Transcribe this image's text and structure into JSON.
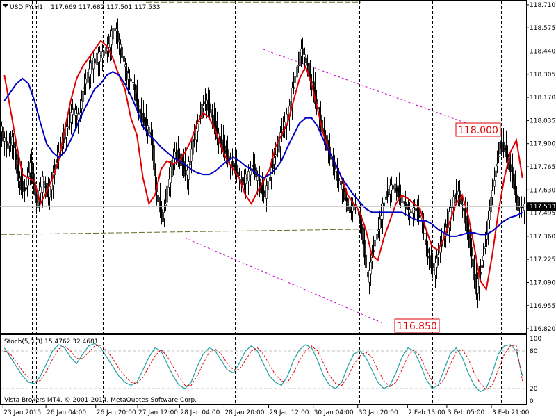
{
  "header": {
    "symbol_tf": "USDJPY,H1",
    "ohlc": "117.669 117.682 117.501 117.533"
  },
  "sub_header": "Stoch(5,3,3) 15.4762 32.4681",
  "copyright": "Vista Brokers MT4, © 2001-2014, MetaQuotes Software Corp.",
  "chart_data": {
    "type": "candlestick",
    "price_axis": {
      "ylim": [
        116.8,
        118.73
      ],
      "ticks": [
        "118.710",
        "118.575",
        "118.440",
        "118.305",
        "118.170",
        "118.035",
        "117.900",
        "117.765",
        "117.630",
        "117.495",
        "117.360",
        "117.225",
        "117.090",
        "116.955",
        "116.820"
      ],
      "current_price": "117.533"
    },
    "time_axis": {
      "labels": [
        "23 Jan 2015",
        "26 Jan 04:00",
        "26 Jan 20:00",
        "27 Jan 12:00",
        "28 Jan 04:00",
        "28 Jan 20:00",
        "29 Jan 12:00",
        "30 Jan 04:00",
        "30 Jan 20:00",
        "2 Feb 13:00",
        "3 Feb 05:00",
        "3 Feb 21:00"
      ]
    },
    "annotations": {
      "high_label": "118.000",
      "low_label": "116.850"
    },
    "price_series": [
      118.0,
      117.88,
      117.92,
      117.7,
      117.62,
      117.78,
      117.55,
      117.68,
      117.6,
      117.75,
      117.88,
      117.98,
      118.1,
      118.05,
      118.25,
      118.35,
      118.4,
      118.42,
      118.48,
      118.58,
      118.45,
      118.3,
      118.25,
      118.1,
      118.02,
      117.95,
      117.6,
      117.45,
      117.7,
      117.85,
      117.8,
      117.72,
      117.9,
      118.05,
      118.15,
      118.08,
      117.95,
      117.88,
      117.8,
      117.75,
      117.68,
      117.7,
      117.78,
      117.65,
      117.6,
      117.75,
      117.88,
      118.0,
      118.1,
      118.3,
      118.45,
      118.35,
      118.2,
      118.05,
      117.92,
      117.8,
      117.7,
      117.62,
      117.5,
      117.55,
      117.4,
      117.1,
      117.3,
      117.45,
      117.6,
      117.65,
      117.62,
      117.55,
      117.5,
      117.52,
      117.45,
      117.25,
      117.15,
      117.3,
      117.4,
      117.55,
      117.62,
      117.5,
      117.3,
      117.05,
      117.2,
      117.45,
      117.7,
      117.9,
      117.85,
      117.7,
      117.53
    ],
    "moving_averages": [
      {
        "color": "#e00000",
        "values": [
          118.3,
          118.1,
          117.9,
          117.72,
          117.7,
          117.68,
          117.55,
          117.62,
          117.7,
          117.8,
          117.98,
          118.15,
          118.28,
          118.35,
          118.4,
          118.45,
          118.5,
          118.47,
          118.4,
          118.3,
          118.22,
          118.05,
          117.95,
          117.7,
          117.55,
          117.6,
          117.75,
          117.8,
          117.78,
          117.8,
          117.85,
          117.92,
          118.02,
          118.08,
          118.05,
          117.98,
          117.88,
          117.8,
          117.75,
          117.7,
          117.6,
          117.55,
          117.62,
          117.68,
          117.75,
          117.88,
          117.95,
          118.02,
          118.15,
          118.28,
          118.35,
          118.25,
          118.1,
          117.95,
          117.85,
          117.78,
          117.7,
          117.6,
          117.55,
          117.5,
          117.4,
          117.25,
          117.22,
          117.35,
          117.45,
          117.55,
          117.6,
          117.58,
          117.55,
          117.52,
          117.4,
          117.3,
          117.28,
          117.35,
          117.45,
          117.55,
          117.6,
          117.48,
          117.3,
          117.1,
          117.05,
          117.25,
          117.5,
          117.7,
          117.85,
          117.92,
          117.7
        ]
      },
      {
        "color": "#0000c0",
        "values": [
          118.15,
          118.2,
          118.25,
          118.28,
          118.25,
          118.15,
          118.02,
          117.9,
          117.85,
          117.82,
          117.85,
          117.92,
          118.0,
          118.08,
          118.15,
          118.22,
          118.25,
          118.3,
          118.32,
          118.3,
          118.25,
          118.18,
          118.1,
          118.0,
          117.95,
          117.92,
          117.88,
          117.85,
          117.82,
          117.8,
          117.78,
          117.75,
          117.73,
          117.72,
          117.72,
          117.74,
          117.77,
          117.8,
          117.82,
          117.8,
          117.77,
          117.75,
          117.72,
          117.7,
          117.72,
          117.75,
          117.8,
          117.88,
          117.95,
          118.02,
          118.05,
          118.05,
          118.0,
          117.92,
          117.85,
          117.78,
          117.7,
          117.65,
          117.6,
          117.56,
          117.52,
          117.5,
          117.5,
          117.5,
          117.5,
          117.5,
          117.5,
          117.48,
          117.46,
          117.45,
          117.45,
          117.43,
          117.4,
          117.38,
          117.36,
          117.36,
          117.37,
          117.38,
          117.38,
          117.37,
          117.37,
          117.39,
          117.42,
          117.45,
          117.47,
          117.48,
          117.5
        ]
      }
    ],
    "channel_lines": {
      "upper": {
        "from": [
          0.5,
          118.45
        ],
        "to": [
          0.95,
          117.95
        ]
      },
      "lower": {
        "from": [
          0.35,
          117.35
        ],
        "to": [
          0.73,
          116.85
        ]
      }
    },
    "horizontal_levels": [
      118.725,
      117.37
    ],
    "stochastic": {
      "ylim": [
        0,
        100
      ],
      "levels": [
        20,
        80
      ],
      "tick_labels": [
        "100",
        "80",
        "20",
        "0"
      ],
      "main": [
        85,
        70,
        55,
        40,
        30,
        28,
        40,
        60,
        80,
        90,
        85,
        70,
        60,
        75,
        88,
        92,
        85,
        70,
        55,
        40,
        30,
        25,
        30,
        50,
        70,
        85,
        80,
        60,
        40,
        25,
        20,
        30,
        55,
        75,
        85,
        80,
        65,
        50,
        45,
        60,
        80,
        88,
        80,
        60,
        40,
        30,
        25,
        40,
        65,
        82,
        90,
        85,
        65,
        40,
        25,
        20,
        30,
        55,
        75,
        80,
        70,
        50,
        30,
        20,
        25,
        45,
        70,
        85,
        80,
        60,
        35,
        20,
        25,
        50,
        75,
        85,
        70,
        45,
        25,
        15,
        20,
        45,
        75,
        88,
        90,
        80,
        40
      ],
      "signal": [
        80,
        75,
        62,
        48,
        37,
        30,
        33,
        48,
        67,
        83,
        88,
        80,
        68,
        68,
        78,
        88,
        89,
        80,
        68,
        52,
        40,
        30,
        28,
        38,
        55,
        72,
        82,
        72,
        55,
        38,
        25,
        25,
        40,
        60,
        78,
        83,
        75,
        60,
        50,
        50,
        65,
        80,
        85,
        75,
        58,
        42,
        32,
        30,
        45,
        65,
        80,
        88,
        80,
        60,
        40,
        28,
        25,
        38,
        58,
        72,
        78,
        70,
        50,
        32,
        23,
        30,
        50,
        72,
        82,
        72,
        50,
        32,
        24,
        35,
        58,
        78,
        82,
        68,
        45,
        28,
        18,
        25,
        50,
        75,
        88,
        88,
        32
      ]
    }
  }
}
